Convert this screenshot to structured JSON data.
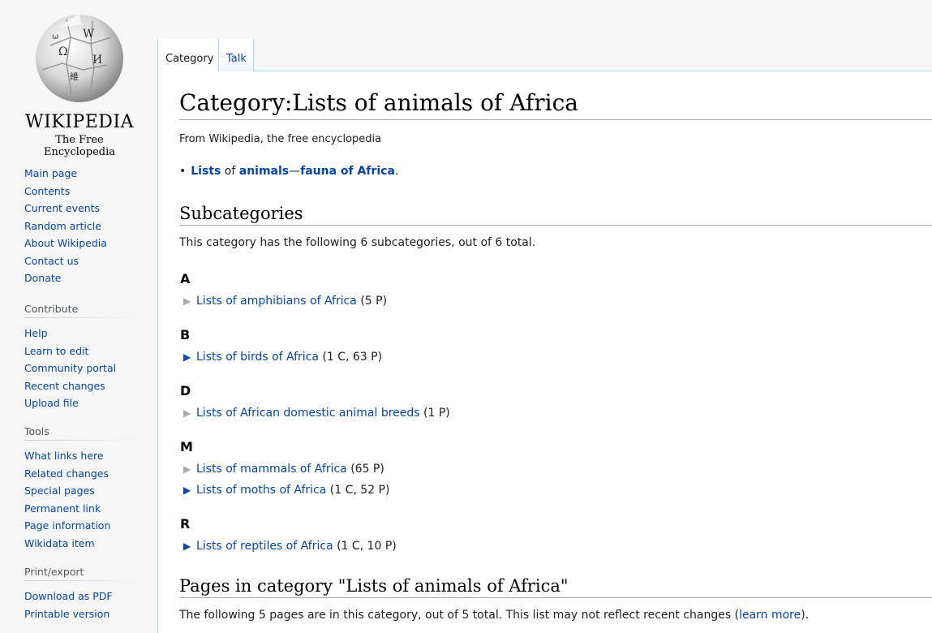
{
  "logo": {
    "wordmark": "WIKIPEDIA",
    "tagline": "The Free Encyclopedia"
  },
  "nav": {
    "main": [
      "Main page",
      "Contents",
      "Current events",
      "Random article",
      "About Wikipedia",
      "Contact us",
      "Donate"
    ],
    "contribute": {
      "heading": "Contribute",
      "items": [
        "Help",
        "Learn to edit",
        "Community portal",
        "Recent changes",
        "Upload file"
      ]
    },
    "tools": {
      "heading": "Tools",
      "items": [
        "What links here",
        "Related changes",
        "Special pages",
        "Permanent link",
        "Page information",
        "Wikidata item"
      ]
    },
    "print": {
      "heading": "Print/export",
      "items": [
        "Download as PDF",
        "Printable version"
      ]
    }
  },
  "tabs": {
    "category": "Category",
    "talk": "Talk"
  },
  "page": {
    "title": "Category:Lists of animals of Africa",
    "subtitle": "From Wikipedia, the free encyclopedia",
    "hatnote": {
      "lists": "Lists",
      "of": " of ",
      "animals": "animals",
      "dash": "—",
      "fauna": "fauna of Africa",
      "end": "."
    },
    "subcategories": {
      "heading": "Subcategories",
      "desc": "This category has the following 6 subcategories, out of 6 total.",
      "groups": [
        {
          "letter": "A",
          "items": [
            {
              "label": "Lists of amphibians of Africa",
              "count": "(5 P)",
              "expandable": false
            }
          ]
        },
        {
          "letter": "B",
          "items": [
            {
              "label": "Lists of birds of Africa",
              "count": "(1 C, 63 P)",
              "expandable": true
            }
          ]
        },
        {
          "letter": "D",
          "items": [
            {
              "label": "Lists of African domestic animal breeds",
              "count": "(1 P)",
              "expandable": false
            }
          ]
        },
        {
          "letter": "M",
          "items": [
            {
              "label": "Lists of mammals of Africa",
              "count": "(65 P)",
              "expandable": false
            },
            {
              "label": "Lists of moths of Africa",
              "count": "(1 C, 52 P)",
              "expandable": true
            }
          ]
        },
        {
          "letter": "R",
          "items": [
            {
              "label": "Lists of reptiles of Africa",
              "count": "(1 C, 10 P)",
              "expandable": true
            }
          ]
        }
      ]
    },
    "pages": {
      "heading": "Pages in category \"Lists of animals of Africa\"",
      "desc_before": "The following 5 pages are in this category, out of 5 total. This list may not reflect recent changes (",
      "learn_more": "learn more",
      "desc_after": ")."
    }
  },
  "colors": {
    "link": "#0645ad",
    "tab_border": "#a7d7f9",
    "sidebar_bg": "#f6f6f6"
  }
}
